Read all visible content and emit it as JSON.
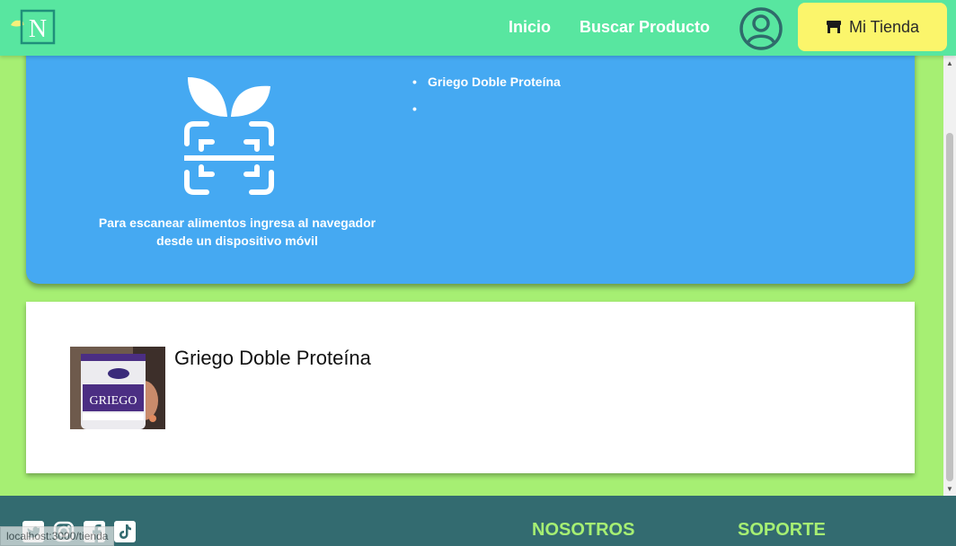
{
  "header": {
    "logo_letter": "N",
    "nav": [
      {
        "label": "Inicio"
      },
      {
        "label": "Buscar Producto"
      }
    ],
    "store_button": "Mi Tienda"
  },
  "scan": {
    "instructions": "Para escanear alimentos ingresa al navegador desde un dispositivo móvil"
  },
  "product_list": [
    "Griego Doble Proteína",
    ""
  ],
  "product_card": {
    "title": "Griego Doble Proteína",
    "image_brand_text": "GRIEGO"
  },
  "footer": {
    "social_icons": [
      "twitter-icon",
      "instagram-icon",
      "facebook-icon",
      "tiktok-icon"
    ],
    "headings": [
      "NOSOTROS",
      "SOPORTE"
    ]
  },
  "status_bar": {
    "url": "localhost:3000/tienda"
  },
  "colors": {
    "header": "#58e6a0",
    "page_bg": "#a6ef73",
    "panel": "#45a9f2",
    "store_button": "#fbf56b",
    "footer": "#336b70",
    "footer_heading": "#a6ef73",
    "profile_icon": "#2f6b6b"
  }
}
